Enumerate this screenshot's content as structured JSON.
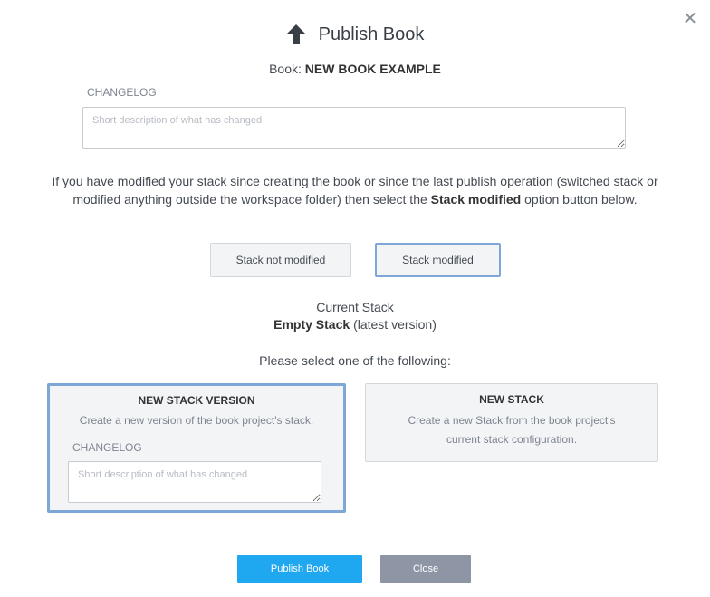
{
  "dialog": {
    "title": "Publish Book",
    "close_symbol": "✕",
    "icons": {
      "title_icon": "arrow-up-icon",
      "close_icon": "close-icon"
    }
  },
  "book": {
    "prefix": "Book:",
    "name": "NEW BOOK EXAMPLE"
  },
  "changelog": {
    "label": "CHANGELOG",
    "placeholder": "Short description of what has changed",
    "value": ""
  },
  "info": {
    "text_before": "If you have modified your stack since creating the book or since the last publish operation (switched stack or modified anything outside the workspace folder) then select the ",
    "emphasis": "Stack modified",
    "text_after": " option button below."
  },
  "stack_options": {
    "not_modified": "Stack not modified",
    "modified": "Stack modified",
    "selected": "modified"
  },
  "current_stack": {
    "label": "Current Stack",
    "name": "Empty Stack",
    "version": "(latest version)"
  },
  "select_prompt": "Please select one of the following:",
  "choices": {
    "new_version": {
      "title": "NEW STACK VERSION",
      "description": "Create a new version of the book project's stack.",
      "changelog_label": "CHANGELOG",
      "placeholder": "Short description of what has changed"
    },
    "new_stack": {
      "title": "NEW STACK",
      "description": "Create a new Stack from the book project's current stack configuration."
    },
    "selected": "new_version"
  },
  "buttons": {
    "publish": "Publish Book",
    "close": "Close"
  },
  "colors": {
    "accent": "#1fa7ef",
    "selection_border": "#7ea6d6",
    "secondary_button": "#8e96a6"
  }
}
